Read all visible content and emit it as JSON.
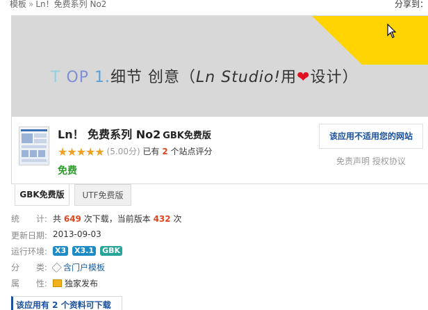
{
  "breadcrumb": {
    "items": [
      "模板",
      "Ln！免费系列 No2"
    ],
    "separator": "»"
  },
  "share_label": "分享到：",
  "banner": {
    "text_t": "T",
    "text_op": "OP",
    "text_one": "1.",
    "text_main": "细节 创意（",
    "text_studio": "Ln Studio!",
    "text_use": "用",
    "text_heart": "❤",
    "text_end": "设计）"
  },
  "product": {
    "title": "Ln！ 免费系列 No2",
    "edition": "GBK免费版",
    "stars": "★★★★★",
    "score": "(5.00分)",
    "rated_prefix": "已有",
    "rated_count": "2",
    "rated_suffix": "个站点评分",
    "price": "免费",
    "report_label": "该应用不适用您的网站",
    "disclaimer": "免责声明",
    "license": "授权协议"
  },
  "tabs": [
    {
      "label": "GBK免费版",
      "active": true
    },
    {
      "label": "UTF免费版",
      "active": false
    }
  ],
  "meta": {
    "stats_label": "统　　计:",
    "stats_prefix": "共",
    "downloads": "649",
    "stats_mid": "次下载，当前版本",
    "version_downloads": "432",
    "stats_suffix": "次",
    "updated_label": "更新日期:",
    "updated": "2013-09-03",
    "env_label": "运行环境:",
    "env": [
      "X3",
      "X3.1",
      "GBK"
    ],
    "category_label": "分　　类:",
    "category": "含门户模板",
    "attr_label": "属　　性:",
    "attr": "独家发布"
  },
  "download_label": "该应用有 2 个资料可下载",
  "colors": {
    "accent": "#1a4f9c",
    "highlight": "#e0461e",
    "free": "#2a9a2a",
    "banner_yellow": "#ffd400"
  }
}
